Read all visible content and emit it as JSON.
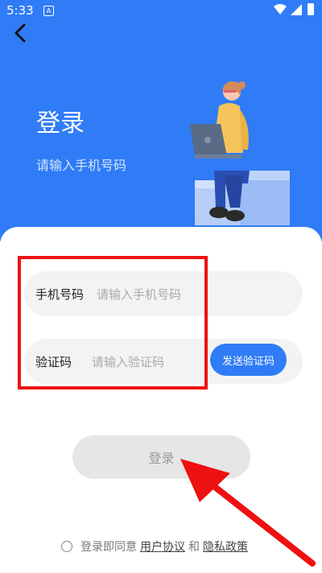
{
  "status_bar": {
    "time": "5:33",
    "notification_glyph": "A"
  },
  "header": {
    "title": "登录",
    "subtitle": "请输入手机号码",
    "background_color": "#2f7cf6"
  },
  "form": {
    "phone": {
      "label": "手机号码",
      "placeholder": "请输入手机号码",
      "value": ""
    },
    "code": {
      "label": "验证码",
      "placeholder": "请输入验证码",
      "value": ""
    },
    "send_code_label": "发送验证码"
  },
  "login_button": {
    "label": "登录"
  },
  "agreement": {
    "prefix": "登录即同意",
    "user_agreement": "用户协议",
    "conjunction": "和",
    "privacy_policy": "隐私政策",
    "checked": false
  },
  "annotations": {
    "highlight_color": "#ee1111",
    "arrow_color": "#ee1111"
  }
}
